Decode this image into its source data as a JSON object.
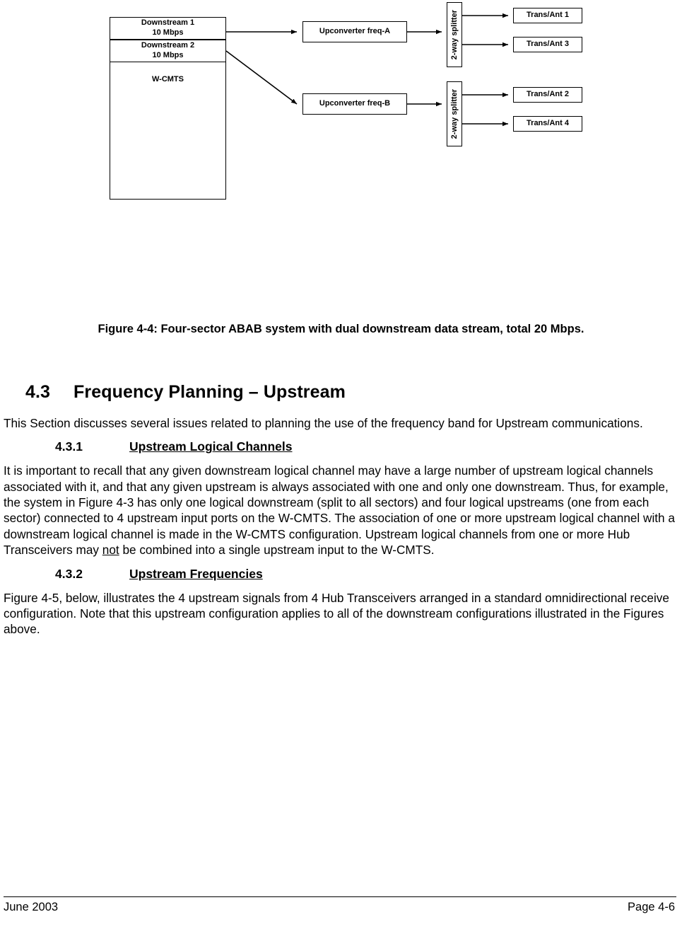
{
  "figure": {
    "wcmts": {
      "downstream1_line1": "Downstream 1",
      "downstream1_line2": "10 Mbps",
      "downstream2_line1": "Downstream 2",
      "downstream2_line2": "10 Mbps",
      "label": "W-CMTS"
    },
    "upconverter_a": "Upconverter freq-A",
    "upconverter_b": "Upconverter freq-B",
    "splitter_1": "2-way splitter",
    "splitter_2": "2-way splitter",
    "antennas": {
      "ant1": "Trans/Ant 1",
      "ant3": "Trans/Ant 3",
      "ant2": "Trans/Ant 2",
      "ant4": "Trans/Ant 4"
    },
    "caption": "Figure 4-4: Four-sector ABAB system with dual downstream data stream, total 20 Mbps."
  },
  "content": {
    "section": {
      "number": "4.3",
      "title": "Frequency Planning – Upstream"
    },
    "intro": "This Section discusses several issues related to planning the use of the frequency band for Upstream communications.",
    "sub1": {
      "number": "4.3.1",
      "title": "Upstream Logical Channels",
      "para_before_not": "It is important to recall that any given downstream logical channel may have a large number of upstream logical channels associated with it, and that any given upstream is always associated with one and only one downstream.  Thus, for example, the system in Figure 4-3 has only one logical downstream (split to all sectors) and four logical upstreams (one from each sector) connected to 4 upstream input ports on the W-CMTS. The association of one or more upstream logical channel with a downstream logical channel is made in the W-CMTS configuration. Upstream logical channels from one or more Hub Transceivers may ",
      "emphasis": "not",
      "para_after_not": " be combined into a single upstream input to the W-CMTS."
    },
    "sub2": {
      "number": "4.3.2",
      "title": "Upstream Frequencies",
      "para": "Figure 4-5, below, illustrates the 4 upstream signals from 4 Hub Transceivers arranged in a standard omnidirectional receive configuration.  Note that this upstream configuration applies to all of the downstream configurations illustrated in the Figures above."
    }
  },
  "footer": {
    "date": "June 2003",
    "page": "Page 4-6"
  }
}
